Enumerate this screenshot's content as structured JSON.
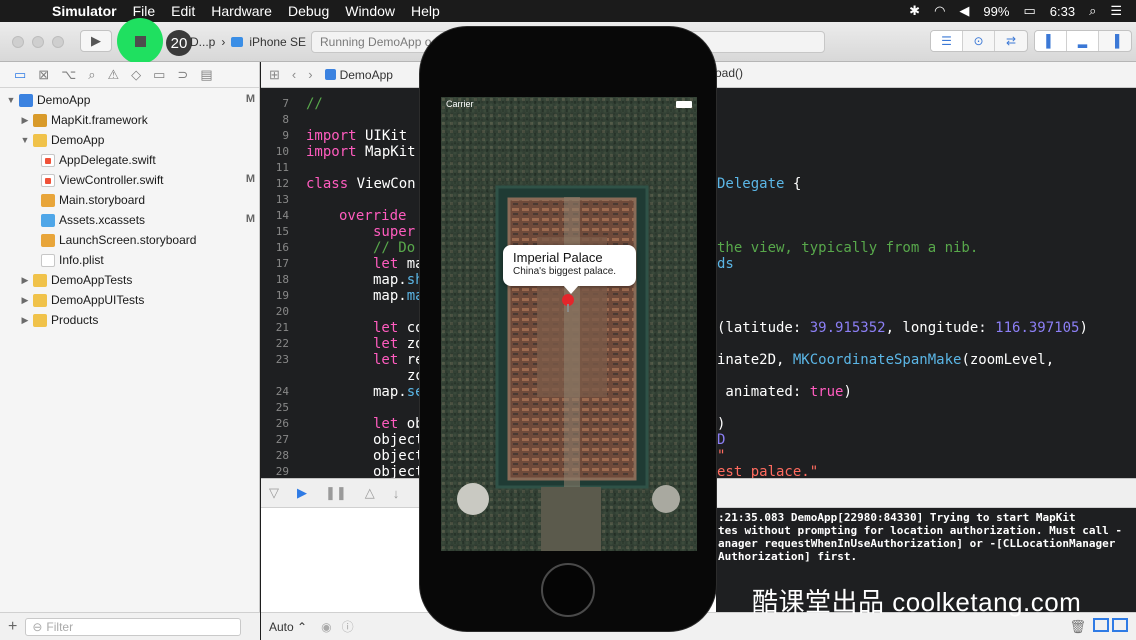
{
  "menubar": {
    "app": "Simulator",
    "items": [
      "File",
      "Edit",
      "Hardware",
      "Debug",
      "Window",
      "Help"
    ],
    "battery": "99%",
    "clock": "6:33"
  },
  "toolbar": {
    "count_badge": "20",
    "scheme": "D...p",
    "device": "iPhone SE",
    "activity": "Running DemoApp o"
  },
  "navigator": {
    "items": [
      {
        "label": "DemoApp",
        "badge": "M"
      },
      {
        "label": "MapKit.framework",
        "badge": ""
      },
      {
        "label": "DemoApp",
        "badge": ""
      },
      {
        "label": "AppDelegate.swift",
        "badge": ""
      },
      {
        "label": "ViewController.swift",
        "badge": "M"
      },
      {
        "label": "Main.storyboard",
        "badge": ""
      },
      {
        "label": "Assets.xcassets",
        "badge": "M"
      },
      {
        "label": "LaunchScreen.storyboard",
        "badge": ""
      },
      {
        "label": "Info.plist",
        "badge": ""
      },
      {
        "label": "DemoAppTests",
        "badge": ""
      },
      {
        "label": "DemoAppUITests",
        "badge": ""
      },
      {
        "label": "Products",
        "badge": ""
      }
    ],
    "filter_placeholder": "Filter"
  },
  "jumpbar": {
    "crumb": "DemoApp",
    "method": "oad()"
  },
  "editor": {
    "line_numbers": [
      "7",
      "8",
      "9",
      "10",
      "11",
      "12",
      "13",
      "14",
      "15",
      "16",
      "17",
      "18",
      "19",
      "20",
      "21",
      "22",
      "23",
      "",
      "24",
      "25",
      "26",
      "27",
      "28",
      "29"
    ],
    "lines": {
      "l7": "//",
      "l9_kw": "import",
      "l9_rest": " UIKit",
      "l10_kw": "import",
      "l10_rest": " MapKit",
      "l12_kw": "class",
      "l12_rest": " ViewCon",
      "l12_ty": "Delegate",
      "l12_end": " {",
      "l14": "override",
      "l15": "super",
      "l16a": "// Do",
      "l16b": "the view, typically from a nib.",
      "l17a": "let",
      "l17b": " ma",
      "l17c": "ds",
      "l18a": "map.",
      "l18b": "sh",
      "l19a": "map.",
      "l19b": "ma",
      "l21a": "let",
      "l21b": " co",
      "l21c": "(latitude: ",
      "l21d": "39.915352",
      "l21e": ", longitude: ",
      "l21f": "116.397105",
      "l21g": ")",
      "l22a": "let",
      "l22b": " zo",
      "l23a": "let",
      "l23b": " re",
      "l23c": "inate2D, ",
      "l23d": "MKCoordinateSpanMake",
      "l23e": "(zoomLevel,",
      "l23cont": "zo",
      "l24a": "map.",
      "l24b": "se",
      "l24c": " animated: ",
      "l24d": "true",
      "l24e": ")",
      "l26a": "let",
      "l26b": " ob",
      "l27": "object",
      "l28": "object",
      "l29": "object",
      "r26": ")",
      "r27": "D",
      "r28": "\"",
      "r29": "est palace.\""
    }
  },
  "console": {
    "lines": [
      ":21:35.083 DemoApp[22980:84330] Trying to start MapKit",
      "tes without prompting for location authorization. Must call -",
      "anager requestWhenInUseAuthorization] or -[CLLocationManager",
      "Authorization] first."
    ]
  },
  "debug_footer": {
    "auto_label": "Auto ⌃"
  },
  "simulator": {
    "carrier": "Carrier",
    "callout_title": "Imperial Palace",
    "callout_subtitle": "China's biggest palace."
  },
  "watermark": "酷课堂出品 coolketang.com",
  "colors": {
    "accent": "#2f7be5",
    "recording_indicator": "#1fe060",
    "pin": "#e4262b"
  }
}
